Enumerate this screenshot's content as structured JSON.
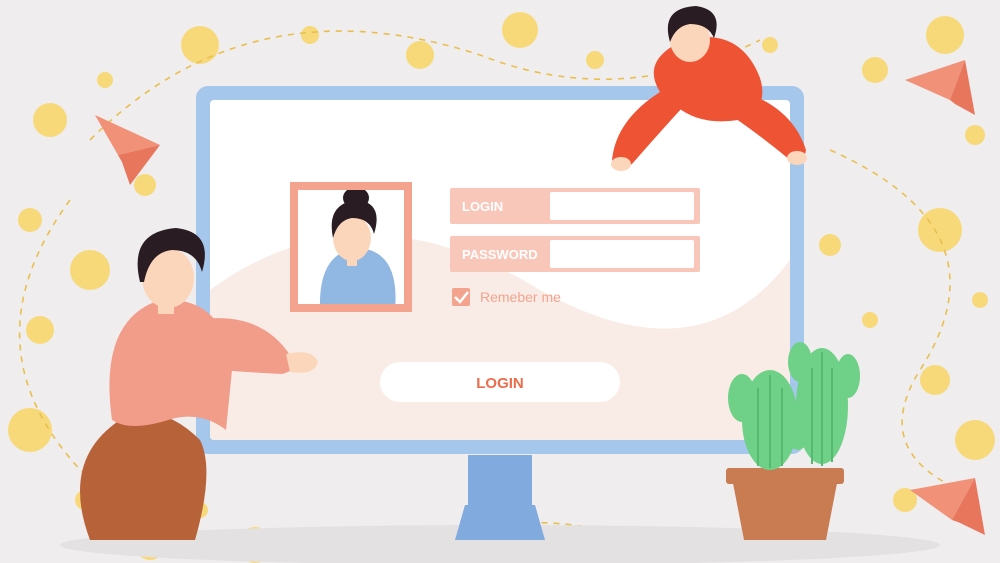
{
  "form": {
    "login_label": "LOGIN",
    "password_label": "PASSWORD",
    "login_value": "",
    "password_value": "",
    "remember_label": "Remeber me",
    "remember_checked": true,
    "submit_label": "LOGIN"
  },
  "colors": {
    "bg": "#efedee",
    "monitor_frame": "#a6c7ec",
    "monitor_stand": "#81aade",
    "screen": "#ffffff",
    "screen_wave": "#f9ece6",
    "accent": "#f4a38e",
    "accent_dark": "#ee6b4b",
    "field_bg": "#f9c7ba",
    "white": "#ffffff",
    "dots": "#f7d97a",
    "dash": "#e9bf4f",
    "skin": "#fcd6bb",
    "hair": "#2a1c23",
    "shirt1": "#f19d8a",
    "pants1": "#b76238",
    "shirt2": "#ee5334",
    "avatar_shirt": "#91b7e3",
    "pot": "#c97c52",
    "cactus": "#6fd187",
    "cactus_dark": "#57b86f"
  }
}
